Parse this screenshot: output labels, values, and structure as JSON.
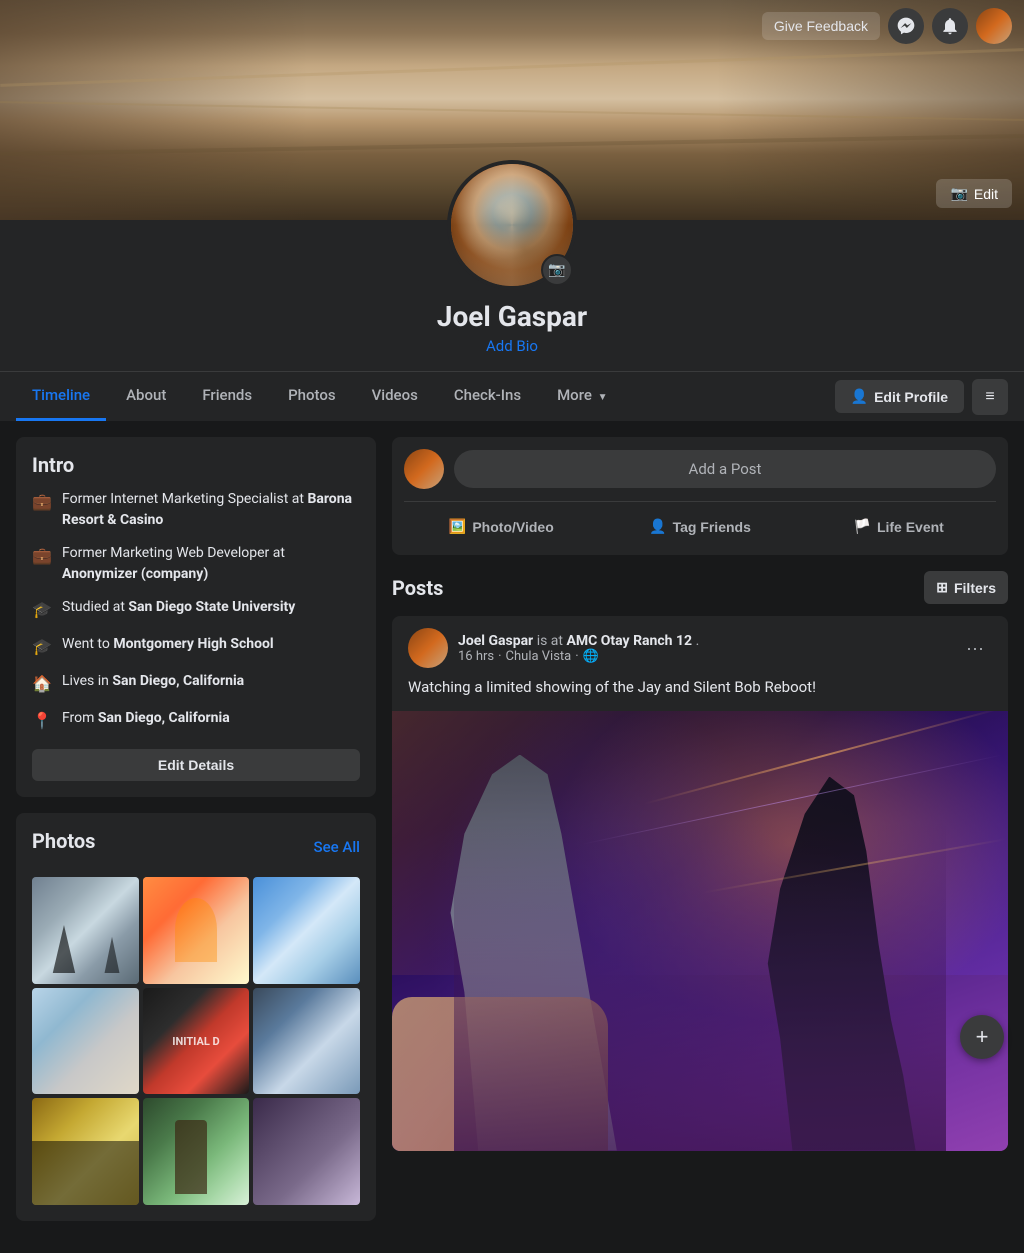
{
  "topbar": {
    "feedback_label": "Give Feedback",
    "messenger_icon": "messenger",
    "notifications_icon": "bell"
  },
  "cover": {
    "edit_label": "Edit"
  },
  "profile": {
    "name": "Joel Gaspar",
    "add_bio_label": "Add Bio",
    "camera_btn_label": "📷"
  },
  "nav": {
    "tabs": [
      {
        "id": "timeline",
        "label": "Timeline",
        "active": true
      },
      {
        "id": "about",
        "label": "About",
        "active": false
      },
      {
        "id": "friends",
        "label": "Friends",
        "active": false
      },
      {
        "id": "photos",
        "label": "Photos",
        "active": false
      },
      {
        "id": "videos",
        "label": "Videos",
        "active": false
      },
      {
        "id": "checkins",
        "label": "Check-Ins",
        "active": false
      },
      {
        "id": "more",
        "label": "More",
        "active": false
      }
    ],
    "edit_profile_label": "Edit Profile",
    "edit_profile_icon": "👤"
  },
  "intro": {
    "title": "Intro",
    "items": [
      {
        "icon": "💼",
        "text": "Former Internet Marketing Specialist at ",
        "bold": "Barona Resort & Casino"
      },
      {
        "icon": "💼",
        "text": "Former Marketing Web Developer at ",
        "bold": "Anonymizer (company)"
      },
      {
        "icon": "🎓",
        "text": "Studied at ",
        "bold": "San Diego State University"
      },
      {
        "icon": "🎓",
        "text": "Went to ",
        "bold": "Montgomery High School"
      },
      {
        "icon": "🏠",
        "text": "Lives in ",
        "bold": "San Diego, California"
      },
      {
        "icon": "📍",
        "text": "From ",
        "bold": "San Diego, California"
      }
    ],
    "edit_details_label": "Edit Details"
  },
  "photos": {
    "title": "Photos",
    "see_all_label": "See All",
    "items": [
      {
        "id": 1,
        "class": "pt1"
      },
      {
        "id": 2,
        "class": "pt2"
      },
      {
        "id": 3,
        "class": "pt3"
      },
      {
        "id": 4,
        "class": "pt4"
      },
      {
        "id": 5,
        "class": "pt5"
      },
      {
        "id": 6,
        "class": "pt6"
      },
      {
        "id": 7,
        "class": "pt7"
      },
      {
        "id": 8,
        "class": "pt8"
      },
      {
        "id": 9,
        "class": "pt9"
      }
    ]
  },
  "add_post": {
    "placeholder": "Add a Post",
    "photo_video_label": "Photo/Video",
    "tag_friends_label": "Tag Friends",
    "life_event_label": "Life Event"
  },
  "posts": {
    "title": "Posts",
    "filters_label": "Filters",
    "items": [
      {
        "author": "Joel Gaspar",
        "checkin_prefix": "is at",
        "location": "AMC Otay Ranch 12",
        "time": "16 hrs",
        "place": "Chula Vista",
        "text": "Watching a limited showing of the Jay and Silent Bob Reboot!"
      }
    ]
  },
  "colors": {
    "accent": "#1877f2",
    "bg_dark": "#18191a",
    "bg_card": "#242526",
    "bg_input": "#3a3b3c",
    "text_primary": "#e4e6eb",
    "text_secondary": "#b0b3b8"
  }
}
